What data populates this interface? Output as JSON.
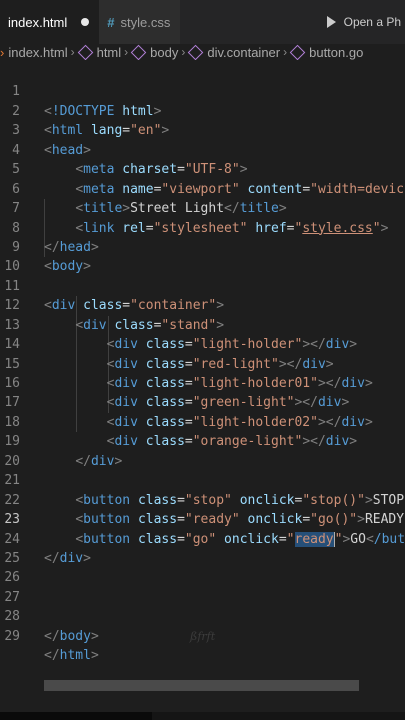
{
  "tabs": [
    {
      "label": "index.html",
      "active": true,
      "modified": true
    },
    {
      "label": "style.css",
      "active": false,
      "icon": "css-hash-icon"
    }
  ],
  "toolbar": {
    "action_label": "Open a Ph",
    "action_icon": "play-icon"
  },
  "breadcrumbs": [
    "index.html",
    "html",
    "body",
    "div.container",
    "button.go"
  ],
  "line_numbers": [
    "1",
    "2",
    "3",
    "4",
    "5",
    "6",
    "7",
    "8",
    "9",
    "10",
    "11",
    "12",
    "13",
    "14",
    "15",
    "16",
    "17",
    "18",
    "19",
    "20",
    "21",
    "22",
    "23",
    "24",
    "25",
    "26",
    "27",
    "28",
    "29"
  ],
  "active_line": "23",
  "code": {
    "doctype": "!DOCTYPE",
    "html": "html",
    "lang_attr": "lang",
    "lang_val": "\"en\"",
    "head": "head",
    "meta": "meta",
    "charset_attr": "charset",
    "charset_val": "\"UTF-8\"",
    "name_attr": "name",
    "name_val": "\"viewport\"",
    "content_attr": "content",
    "content_val": "\"width=devic",
    "title": "title",
    "title_text": "Street Light",
    "link": "link",
    "rel_attr": "rel",
    "rel_val": "\"stylesheet\"",
    "href_attr": "href",
    "href_val": "style.css",
    "body": "body",
    "div": "div",
    "class_attr": "class",
    "container_val": "\"container\"",
    "stand_val": "\"stand\"",
    "light_holder_val": "\"light-holder\"",
    "red_light_val": "\"red-light\"",
    "light_holder01_val": "\"light-holder01\"",
    "green_light_val": "\"green-light\"",
    "light_holder02_val": "\"light-holder02\"",
    "orange_light_val": "\"orange-light\"",
    "button": "button",
    "onclick_attr": "onclick",
    "stop_class_val": "\"stop\"",
    "stop_fn_val": "\"stop()\"",
    "stop_text": "STOP",
    "ready_class_val": "\"ready\"",
    "go_fn_val": "\"go()\"",
    "ready_text": "READY",
    "go_class_val": "\"go\"",
    "ready_fn_open": "\"",
    "ready_fn_sel": "ready",
    "ready_fn_close": "\"",
    "go_text": "GO",
    "close_but": "/but"
  },
  "watermark": "ßfrft",
  "colors": {
    "tag": "#569cd6",
    "attribute": "#9cdcfe",
    "string": "#ce9178",
    "text": "#d4d4d4",
    "bracket": "#808080",
    "background": "#1e1e1e"
  }
}
